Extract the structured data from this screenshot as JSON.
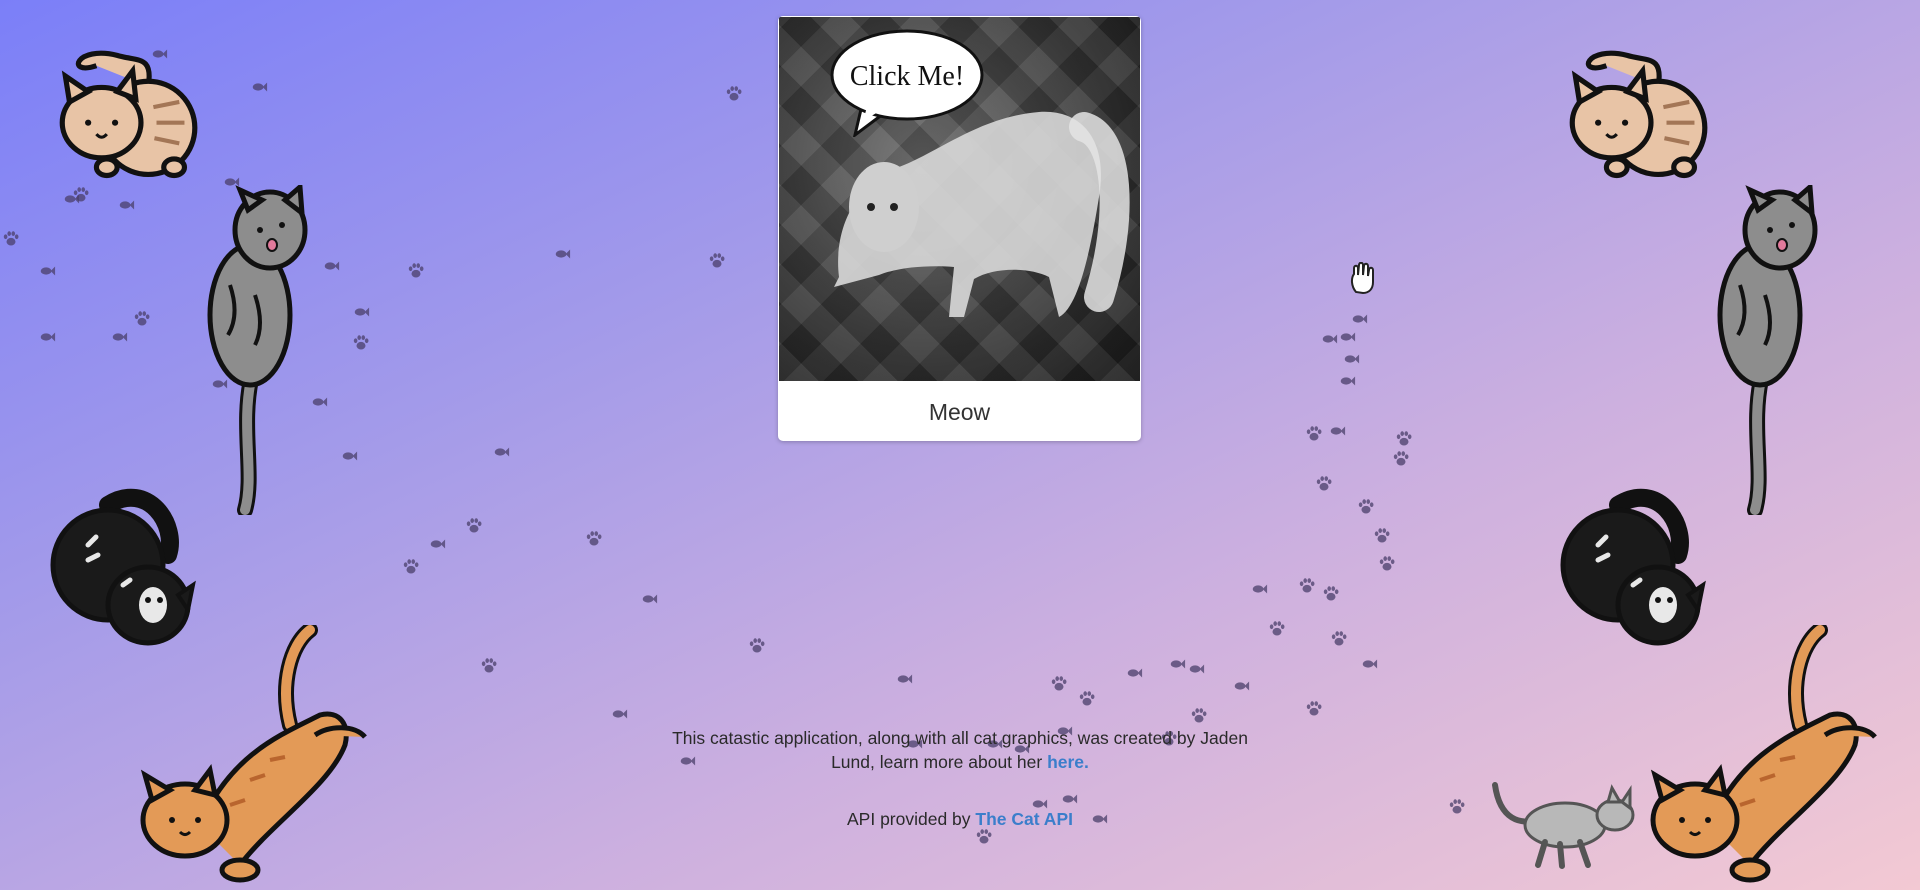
{
  "card": {
    "bubble_text": "Click Me!",
    "caption": "Meow"
  },
  "footer": {
    "credit_prefix": "This catastic application, along with all cat graphics, was created by Jaden Lund, learn more about her",
    "credit_link": "here.",
    "api_prefix": "API provided by",
    "api_link": "The Cat API"
  },
  "colors": {
    "gradient_start": "#7b7ff8",
    "gradient_end": "#f3c9d3",
    "link": "#3b7ecb",
    "paw_trail": "#4a3f6a"
  },
  "icons": {
    "cursor": "hand-cursor-icon",
    "trail": [
      "paw-print-icon",
      "fish-icon"
    ],
    "side_cats": [
      "cream-cat-icon",
      "gray-tabby-cat-icon",
      "black-cat-icon",
      "orange-tabby-cat-icon"
    ]
  }
}
